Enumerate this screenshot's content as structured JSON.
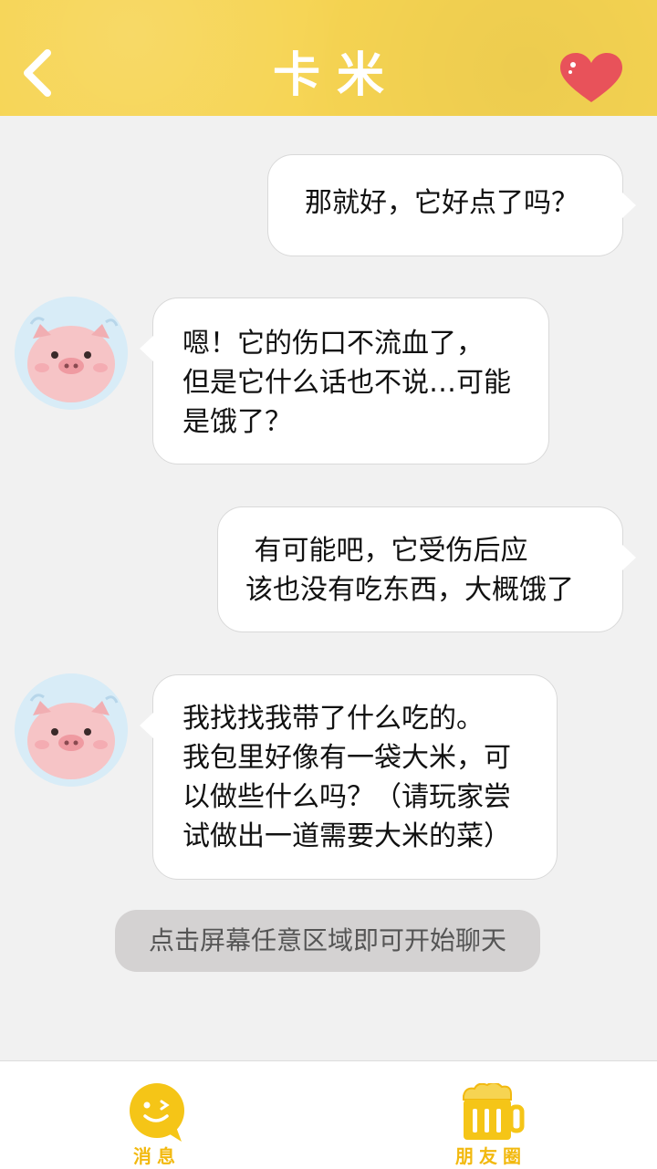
{
  "header": {
    "title": "卡米",
    "back_icon": "chevron-left-icon",
    "favorite_icon": "heart-icon",
    "colors": {
      "background": "#f6d452",
      "heart": "#e8525a"
    }
  },
  "messages": [
    {
      "side": "right",
      "lines": [
        "那就好，它好点了吗？"
      ]
    },
    {
      "side": "left",
      "lines": [
        "嗯！它的伤口不流血了，",
        "但是它什么话也不说…可能",
        "是饿了？"
      ]
    },
    {
      "side": "right",
      "lines": [
        " 有可能吧，它受伤后应",
        "该也没有吃东西，大概饿了"
      ]
    },
    {
      "side": "left",
      "lines": [
        "我找找我带了什么吃的。",
        "我包里好像有一袋大米，可",
        "以做些什么吗？（请玩家尝",
        "试做出一道需要大米的菜）"
      ]
    }
  ],
  "hint": "点击屏幕任意区域即可开始聊天",
  "tabbar": {
    "tabs": [
      {
        "label": "消息",
        "icon": "chat-bubble-icon"
      },
      {
        "label": "朋友圈",
        "icon": "beer-mug-icon"
      }
    ],
    "accent": "#f2b90f"
  }
}
